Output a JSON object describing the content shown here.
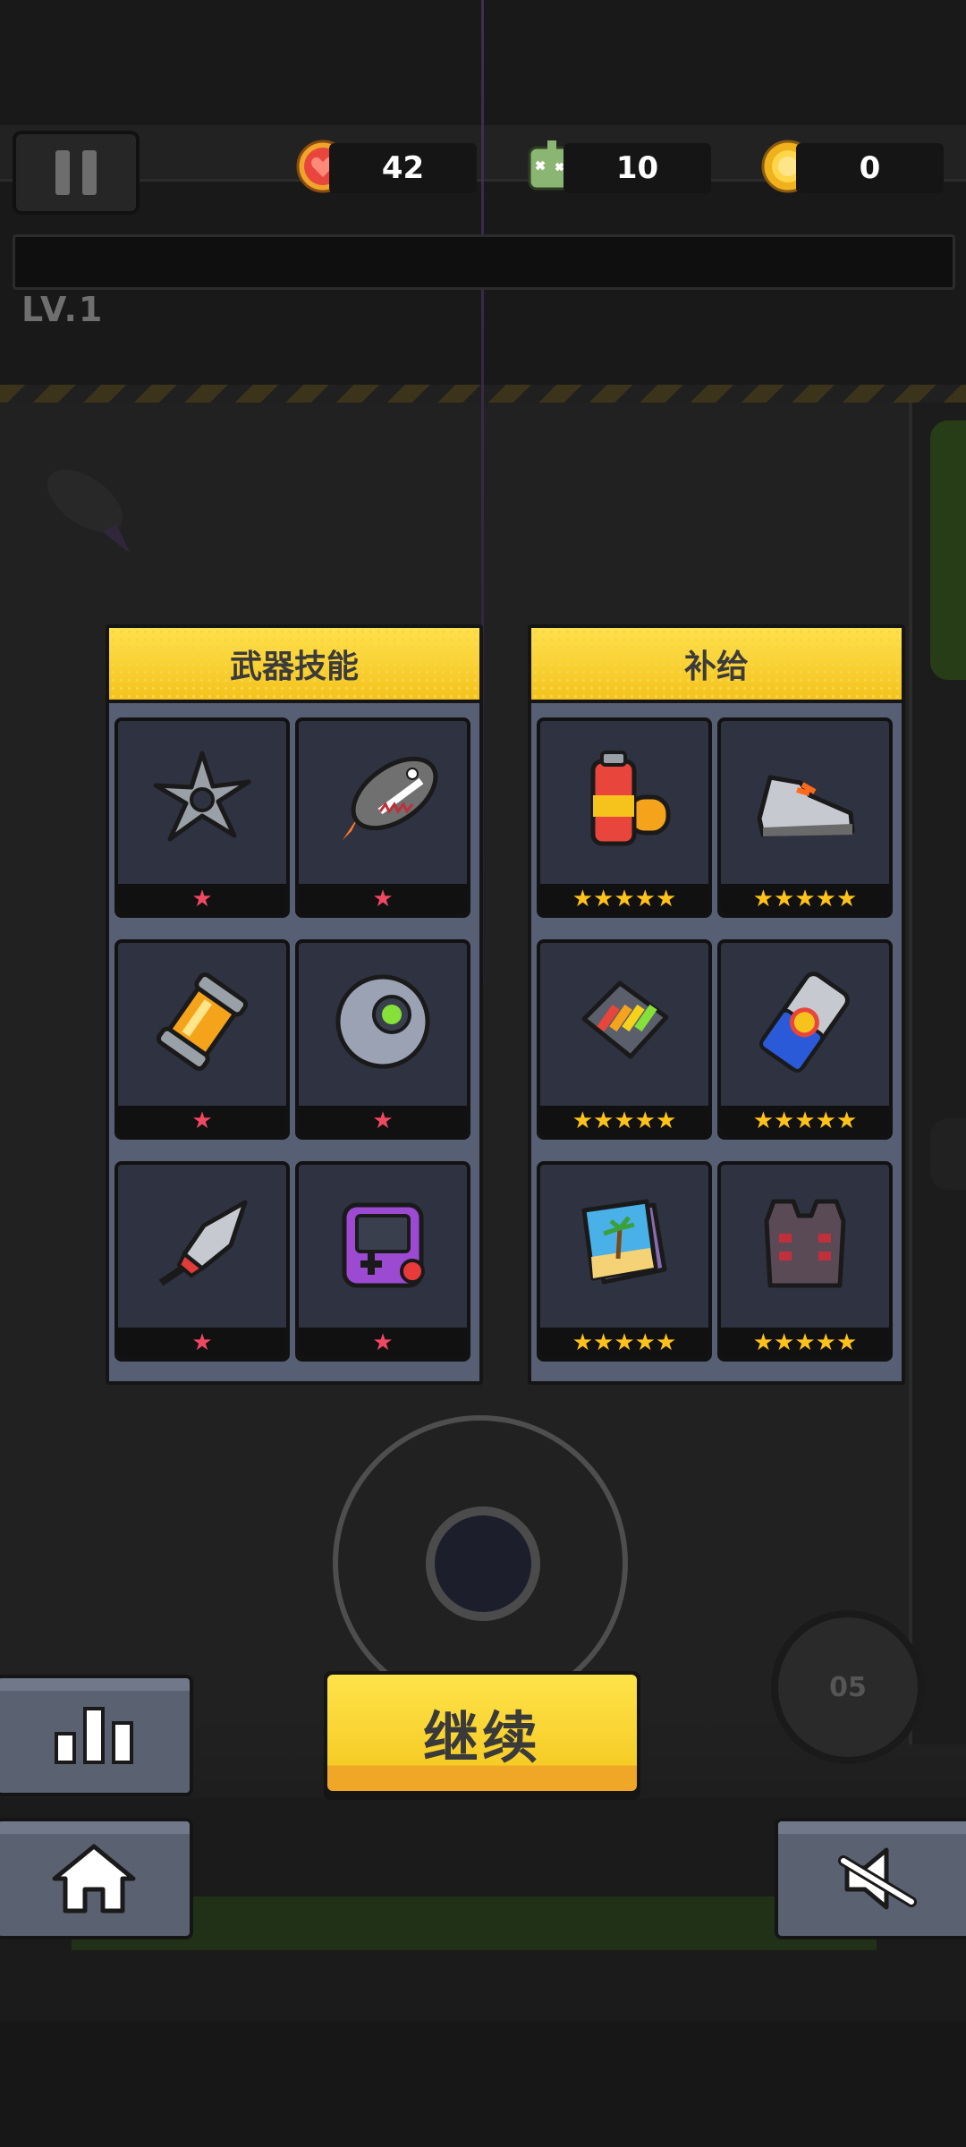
{
  "hud": {
    "hearts": "42",
    "kills": "10",
    "coins": "0",
    "level": "LV.1"
  },
  "panels": {
    "weapon_title": "武器技能",
    "supply_title": "补给"
  },
  "weapon_skills": [
    {
      "icon": "shuriken-icon",
      "stars": "★"
    },
    {
      "icon": "shark-rocket-icon",
      "stars": "★"
    },
    {
      "icon": "energy-canister-icon",
      "stars": "★"
    },
    {
      "icon": "drone-orb-icon",
      "stars": "★"
    },
    {
      "icon": "kunai-icon",
      "stars": "★"
    },
    {
      "icon": "gameboy-icon",
      "stars": "★"
    }
  ],
  "supplies": [
    {
      "icon": "battery-icon",
      "stars": "★★★★★"
    },
    {
      "icon": "sneaker-icon",
      "stars": "★★★★★"
    },
    {
      "icon": "ammo-clip-icon",
      "stars": "★★★★★"
    },
    {
      "icon": "energy-drink-icon",
      "stars": "★★★★★"
    },
    {
      "icon": "book-icon",
      "stars": "★★★★★"
    },
    {
      "icon": "armor-vest-icon",
      "stars": "★★★★★"
    }
  ],
  "buttons": {
    "continue": "继续",
    "skill_counter": "05"
  },
  "colors": {
    "panel_header": "#f6cc26",
    "star_weapon": "#f04862",
    "star_supply": "#ffc21a"
  }
}
